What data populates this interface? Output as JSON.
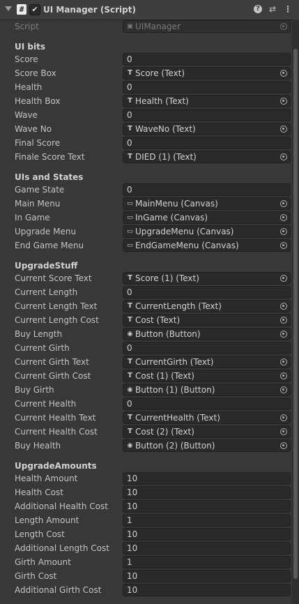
{
  "header": {
    "title": "UI Manager (Script)",
    "script_glyph": "#",
    "check_glyph": "✔",
    "help_glyph": "?",
    "preset_glyph": "⇄",
    "menu_glyph": "⋮"
  },
  "script_row": {
    "label": "Script",
    "value": "UIManager"
  },
  "sections": [
    {
      "title": "UI bits",
      "rows": [
        {
          "label": "Score",
          "value": "0",
          "kind": "num"
        },
        {
          "label": "Score Box",
          "value": "Score (Text)",
          "kind": "text"
        },
        {
          "label": "Health",
          "value": "0",
          "kind": "num"
        },
        {
          "label": "Health Box",
          "value": "Health (Text)",
          "kind": "text"
        },
        {
          "label": "Wave",
          "value": "0",
          "kind": "num"
        },
        {
          "label": "Wave No",
          "value": "WaveNo (Text)",
          "kind": "text"
        },
        {
          "label": "Final Score",
          "value": "0",
          "kind": "num"
        },
        {
          "label": "Finale Score Text",
          "value": "DIED (1) (Text)",
          "kind": "text"
        }
      ]
    },
    {
      "title": "UIs and States",
      "rows": [
        {
          "label": "Game State",
          "value": "0",
          "kind": "num"
        },
        {
          "label": "Main Menu",
          "value": "MainMenu (Canvas)",
          "kind": "canvas"
        },
        {
          "label": "In Game",
          "value": "InGame (Canvas)",
          "kind": "canvas"
        },
        {
          "label": "Upgrade Menu",
          "value": "UpgradeMenu (Canvas)",
          "kind": "canvas"
        },
        {
          "label": "End Game Menu",
          "value": "EndGameMenu (Canvas)",
          "kind": "canvas"
        }
      ]
    },
    {
      "title": "UpgradeStuff",
      "rows": [
        {
          "label": "Current Score Text",
          "value": "Score (1) (Text)",
          "kind": "text"
        },
        {
          "label": "Current Length",
          "value": "0",
          "kind": "num"
        },
        {
          "label": "Current Length Text",
          "value": "CurrentLength (Text)",
          "kind": "text"
        },
        {
          "label": "Current Length Cost",
          "value": "Cost (Text)",
          "kind": "text"
        },
        {
          "label": "Buy Length",
          "value": "Button (Button)",
          "kind": "button"
        },
        {
          "label": "Current Girth",
          "value": "0",
          "kind": "num"
        },
        {
          "label": "Current Girth Text",
          "value": "CurrentGirth (Text)",
          "kind": "text"
        },
        {
          "label": "Current Girth Cost",
          "value": "Cost (1) (Text)",
          "kind": "text"
        },
        {
          "label": "Buy Girth",
          "value": "Button (1) (Button)",
          "kind": "button"
        },
        {
          "label": "Current Health",
          "value": "0",
          "kind": "num"
        },
        {
          "label": "Current Health Text",
          "value": "CurrentHealth (Text)",
          "kind": "text"
        },
        {
          "label": "Current Health Cost",
          "value": "Cost (2) (Text)",
          "kind": "text"
        },
        {
          "label": "Buy Health",
          "value": "Button (2) (Button)",
          "kind": "button"
        }
      ]
    },
    {
      "title": "UpgradeAmounts",
      "rows": [
        {
          "label": "Health Amount",
          "value": "10",
          "kind": "num"
        },
        {
          "label": "Health Cost",
          "value": "10",
          "kind": "num"
        },
        {
          "label": "Additional Health Cost",
          "value": "10",
          "kind": "num"
        },
        {
          "label": "Length Amount",
          "value": "1",
          "kind": "num"
        },
        {
          "label": "Length Cost",
          "value": "10",
          "kind": "num"
        },
        {
          "label": "Additional Length Cost",
          "value": "10",
          "kind": "num"
        },
        {
          "label": "Girth Amount",
          "value": "1",
          "kind": "num"
        },
        {
          "label": "Girth Cost",
          "value": "10",
          "kind": "num"
        },
        {
          "label": "Additional Girth Cost",
          "value": "10",
          "kind": "num"
        }
      ]
    }
  ],
  "icons": {
    "text": "text-component-icon",
    "canvas": "canvas-component-icon",
    "button": "button-component-icon",
    "script": "script-asset-icon"
  }
}
